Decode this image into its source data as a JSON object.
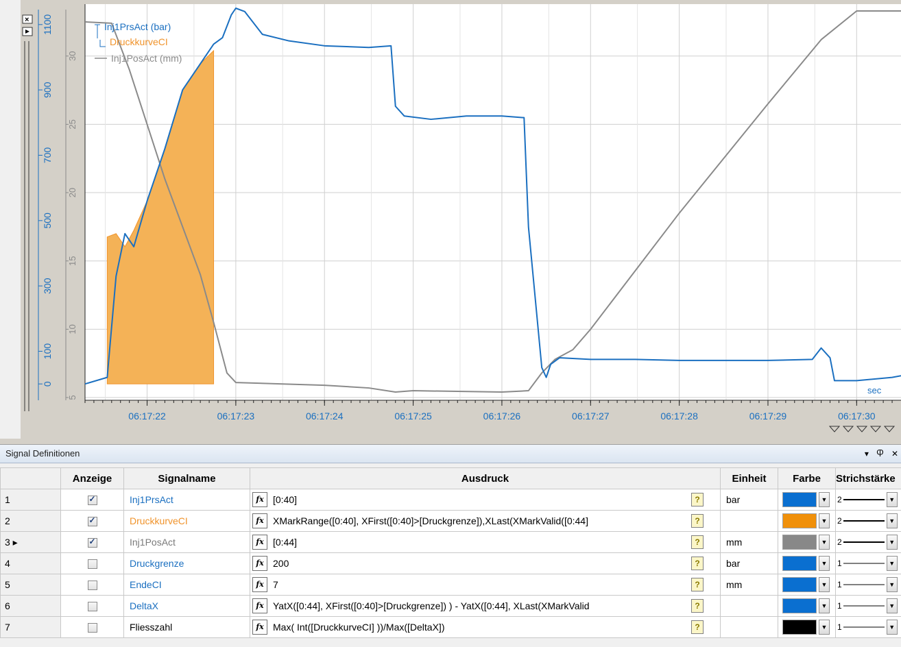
{
  "chart": {
    "legend": [
      {
        "label": "Inj1PrsAct (bar)",
        "color": "#1a6fc0"
      },
      {
        "label": "DruckkurveCI",
        "color": "#f0932b"
      },
      {
        "label": "Inj1PosAct (mm)",
        "color": "#8a8a8a"
      }
    ],
    "unit_label": "sec",
    "x_ticks": [
      "06:17:22",
      "06:17:23",
      "06:17:24",
      "06:17:25",
      "06:17:26",
      "06:17:27",
      "06:17:28",
      "06:17:29",
      "06:17:30"
    ],
    "y_ticks_pressure": [
      "0",
      "100",
      "300",
      "500",
      "700",
      "900",
      "1100"
    ],
    "y_ticks_position": [
      "5",
      "10",
      "15",
      "20",
      "25",
      "30"
    ]
  },
  "chart_data": {
    "type": "line",
    "x_unit": "time (06:17:xx)",
    "xlim": [
      "06:17:21.3",
      "06:17:30.5"
    ],
    "series": [
      {
        "name": "Inj1PrsAct (bar)",
        "color": "#1a6fc0",
        "axis": "pressure",
        "x": [
          21.3,
          21.55,
          21.65,
          21.75,
          21.85,
          22.0,
          22.2,
          22.4,
          22.6,
          22.75,
          22.85,
          22.95,
          23.0,
          23.1,
          23.3,
          23.6,
          24.0,
          24.5,
          24.75,
          24.8,
          24.9,
          25.2,
          25.6,
          26.0,
          26.25,
          26.3,
          26.45,
          26.5,
          26.55,
          26.65,
          27.0,
          27.5,
          28.0,
          28.5,
          29.0,
          29.5,
          29.6,
          29.7,
          29.75,
          30.0,
          30.4,
          30.5
        ],
        "y": [
          0,
          20,
          330,
          460,
          420,
          560,
          720,
          900,
          980,
          1040,
          1060,
          1130,
          1150,
          1140,
          1070,
          1050,
          1035,
          1030,
          1035,
          850,
          820,
          810,
          820,
          820,
          815,
          480,
          50,
          20,
          60,
          80,
          75,
          75,
          72,
          72,
          72,
          75,
          110,
          80,
          10,
          10,
          20,
          25
        ]
      },
      {
        "name": "Inj1PosAct (mm)",
        "color": "#8a8a8a",
        "axis": "position",
        "x": [
          21.3,
          21.6,
          21.8,
          22.0,
          22.2,
          22.4,
          22.6,
          22.75,
          22.9,
          23.0,
          23.5,
          24.0,
          24.5,
          24.8,
          25.0,
          26.0,
          26.3,
          26.45,
          26.6,
          26.8,
          27.0,
          28.0,
          29.0,
          29.6,
          30.0,
          30.5
        ],
        "y": [
          32.5,
          32.4,
          29.0,
          25.0,
          21.0,
          17.5,
          14.0,
          10.5,
          6.8,
          6.1,
          6.0,
          5.9,
          5.7,
          5.4,
          5.5,
          5.4,
          5.5,
          6.8,
          7.8,
          8.5,
          10.0,
          18.5,
          26.5,
          31.2,
          33.3,
          33.3
        ]
      },
      {
        "name": "DruckkurveCI",
        "color": "#f0932b",
        "axis": "pressure",
        "style": "filled-area",
        "x": [
          21.55,
          21.65,
          21.75,
          21.85,
          22.0,
          22.2,
          22.4,
          22.6,
          22.75
        ],
        "y": [
          450,
          460,
          420,
          470,
          560,
          720,
          900,
          980,
          1020
        ]
      }
    ],
    "ylim_pressure": [
      -50,
      1150
    ],
    "ylim_position": [
      4.8,
      33.5
    ]
  },
  "panel": {
    "title": "Signal Definitionen",
    "controls": {
      "menu": "▾",
      "pin": "Ⴔ",
      "close": "✕"
    },
    "columns": {
      "anzeige": "Anzeige",
      "signalname": "Signalname",
      "ausdruck": "Ausdruck",
      "einheit": "Einheit",
      "farbe": "Farbe",
      "strich": "Strichstärke"
    },
    "rows": [
      {
        "num": "1",
        "checked": true,
        "name": "Inj1PrsAct",
        "name_color": "#1a6fc0",
        "expr": "[0:40]",
        "unit": "bar",
        "color": "#0a6fd0",
        "width": "2"
      },
      {
        "num": "2",
        "checked": true,
        "name": "DruckkurveCI",
        "name_color": "#f0932b",
        "expr": "XMarkRange([0:40], XFirst([0:40]>[Druckgrenze]),XLast(XMarkValid([0:44]",
        "unit": "",
        "color": "#f0900a",
        "width": "2"
      },
      {
        "num": "3 ▸",
        "checked": true,
        "name": "Inj1PosAct",
        "name_color": "#7a7a7a",
        "expr": "[0:44]",
        "unit": "mm",
        "color": "#888888",
        "width": "2"
      },
      {
        "num": "4",
        "checked": false,
        "name": "Druckgrenze",
        "name_color": "#1a6fc0",
        "expr": "200",
        "unit": "bar",
        "color": "#0a6fd0",
        "width": "1"
      },
      {
        "num": "5",
        "checked": false,
        "name": "EndeCI",
        "name_color": "#1a6fc0",
        "expr": "7",
        "unit": "mm",
        "color": "#0a6fd0",
        "width": "1"
      },
      {
        "num": "6",
        "checked": false,
        "name": "DeltaX",
        "name_color": "#1a6fc0",
        "expr": "YatX([0:44], XFirst([0:40]>[Druckgrenze]) ) - YatX([0:44], XLast(XMarkValid",
        "unit": "",
        "color": "#0a6fd0",
        "width": "1"
      },
      {
        "num": "7",
        "checked": false,
        "name": "Fliesszahl",
        "name_color": "#000000",
        "expr": "Max( Int([DruckkurveCI] ))/Max([DeltaX])",
        "unit": "",
        "color": "#000000",
        "width": "1"
      }
    ]
  }
}
